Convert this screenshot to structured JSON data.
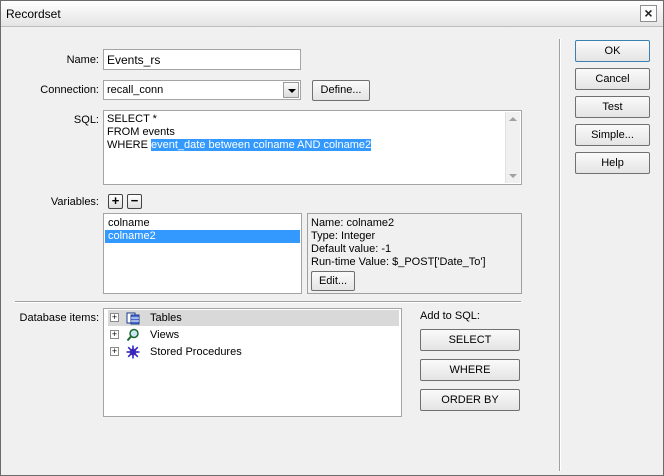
{
  "window": {
    "title": "Recordset"
  },
  "form": {
    "name_label": "Name:",
    "name_value": "Events_rs",
    "connection_label": "Connection:",
    "connection_value": "recall_conn",
    "define_button": "Define...",
    "sql_label": "SQL:",
    "sql_lines": [
      "SELECT *",
      "FROM events",
      "WHERE "
    ],
    "sql_selected": "event_date between colname AND colname2",
    "variables_label": "Variables:",
    "add_variable": "+",
    "remove_variable": "−",
    "variables": [
      "colname",
      "colname2"
    ],
    "selected_variable_index": 1,
    "detail": {
      "name": "Name: colname2",
      "type": "Type: Integer",
      "default": "Default value: -1",
      "runtime": "Run-time Value: $_POST['Date_To']",
      "edit_button": "Edit..."
    },
    "database_items_label": "Database items:",
    "tree": [
      {
        "label": "Tables",
        "icon": "tables-icon",
        "selected": true
      },
      {
        "label": "Views",
        "icon": "views-icon",
        "selected": false
      },
      {
        "label": "Stored Procedures",
        "icon": "stored-procedures-icon",
        "selected": false
      }
    ],
    "add_to_sql_label": "Add to SQL:",
    "add_buttons": [
      "SELECT",
      "WHERE",
      "ORDER BY"
    ]
  },
  "side_buttons": [
    "OK",
    "Cancel",
    "Test",
    "Simple...",
    "Help"
  ],
  "colors": {
    "selection": "#3399ff",
    "dialog_bg": "#f0f0f0"
  }
}
